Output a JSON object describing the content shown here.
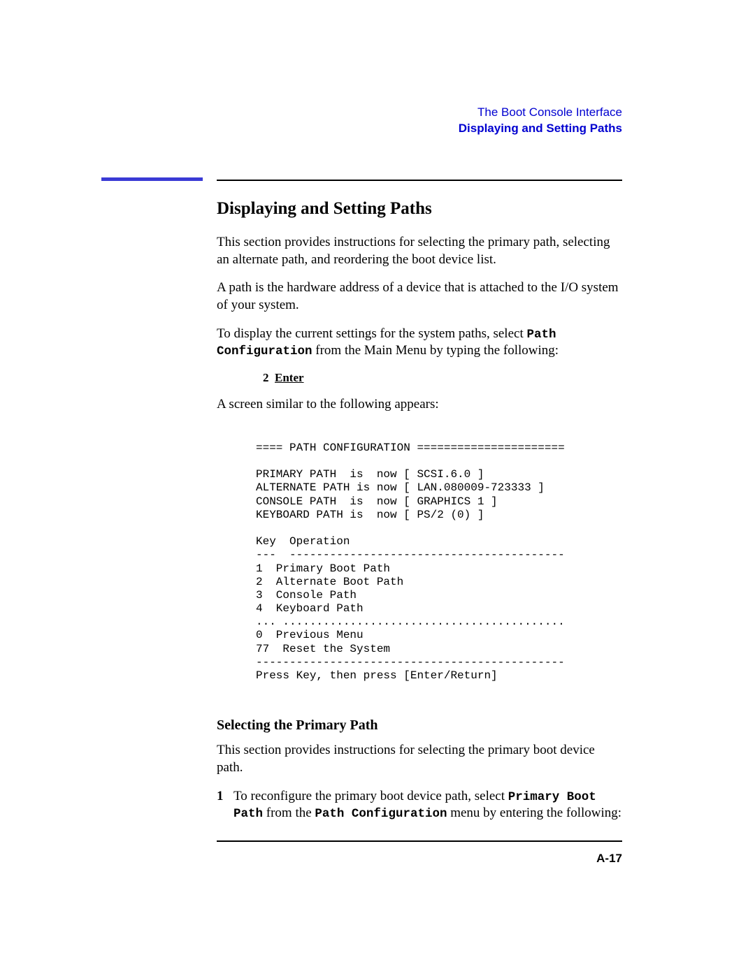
{
  "header": {
    "chapter": "The Boot Console Interface",
    "section": "Displaying and Setting Paths"
  },
  "title": "Displaying and Setting Paths",
  "p1": "This section provides instructions for selecting the primary path, selecting an alternate path, and reordering the boot device list.",
  "p2": "A path is the hardware address of a device that is attached to the I/O system of your system.",
  "p3a": "To display the current settings for the system paths, select ",
  "p3_cmd": "Path Configuration",
  "p3b": " from the Main Menu by typing the following:",
  "enter_num": "2",
  "enter_label": "Enter",
  "p4": "A screen similar to the following appears:",
  "screen": "==== PATH CONFIGURATION ======================\n\nPRIMARY PATH  is  now [ SCSI.6.0 ]\nALTERNATE PATH is now [ LAN.080009-723333 ]\nCONSOLE PATH  is  now [ GRAPHICS 1 ]\nKEYBOARD PATH is  now [ PS/2 (0) ]\n\nKey  Operation\n---  -----------------------------------------\n1  Primary Boot Path\n2  Alternate Boot Path\n3  Console Path\n4  Keyboard Path\n... ..........................................\n0  Previous Menu\n77  Reset the System\n----------------------------------------------\nPress Key, then press [Enter/Return]",
  "subheading": "Selecting the Primary Path",
  "p5": "This section provides instructions for selecting the primary boot device path.",
  "step1_num": "1",
  "step1_a": "To reconfigure the primary boot device path, select ",
  "step1_cmd1": "Primary Boot Path",
  "step1_b": " from the ",
  "step1_cmd2": "Path Configuration",
  "step1_c": " menu by entering the following:",
  "page_number": "A-17"
}
